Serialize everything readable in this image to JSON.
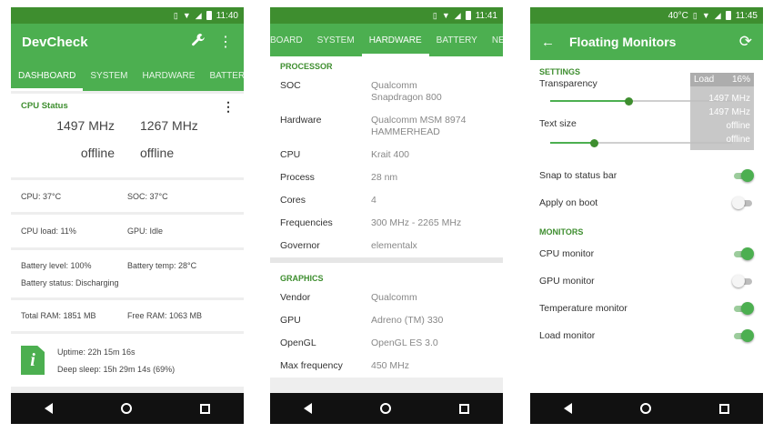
{
  "screen1": {
    "status_time": "11:40",
    "app_title": "DevCheck",
    "tabs": [
      "DASHBOARD",
      "SYSTEM",
      "HARDWARE",
      "BATTERY"
    ],
    "cpu_status": {
      "title": "CPU Status",
      "freqs": [
        "1497 MHz",
        "1267 MHz",
        "offline",
        "offline"
      ]
    },
    "temps": {
      "cpu": "CPU: 37°C",
      "soc": "SOC: 37°C"
    },
    "load": {
      "cpu": "CPU load: 11%",
      "gpu": "GPU: Idle"
    },
    "battery": {
      "level": "Battery level: 100%",
      "temp": "Battery temp: 28°C",
      "status": "Battery status: Discharging"
    },
    "ram": {
      "total": "Total RAM: 1851 MB",
      "free": "Free RAM: 1063 MB"
    },
    "uptime": {
      "uptime": "Uptime: 22h 15m 16s",
      "deep_sleep": "Deep sleep: 15h 29m 14s (69%)",
      "icon_letter": "i"
    }
  },
  "screen2": {
    "status_time": "11:41",
    "tabs": [
      "BOARD",
      "SYSTEM",
      "HARDWARE",
      "BATTERY",
      "NETW"
    ],
    "processor": {
      "header": "PROCESSOR",
      "rows": [
        {
          "k": "SOC",
          "v": "Qualcomm\nSnapdragon 800"
        },
        {
          "k": "Hardware",
          "v": "Qualcomm MSM 8974\nHAMMERHEAD"
        },
        {
          "k": "CPU",
          "v": "Krait 400"
        },
        {
          "k": "Process",
          "v": "28 nm"
        },
        {
          "k": "Cores",
          "v": "4"
        },
        {
          "k": "Frequencies",
          "v": "300 MHz - 2265 MHz"
        },
        {
          "k": "Governor",
          "v": "elementalx"
        }
      ]
    },
    "graphics": {
      "header": "GRAPHICS",
      "rows": [
        {
          "k": "Vendor",
          "v": "Qualcomm"
        },
        {
          "k": "GPU",
          "v": "Adreno (TM) 330"
        },
        {
          "k": "OpenGL",
          "v": "OpenGL ES 3.0"
        },
        {
          "k": "Max frequency",
          "v": "450 MHz"
        }
      ]
    }
  },
  "screen3": {
    "status_time": "11:45",
    "status_temp": "40°C",
    "title": "Floating Monitors",
    "settings_header": "SETTINGS",
    "transparency_label": "Transparency",
    "transparency_value": 0.43,
    "text_size_label": "Text size",
    "text_size_value": 0.24,
    "overlay": {
      "load_label": "Load",
      "load_value": "16%",
      "lines": [
        "1497 MHz",
        "1497 MHz",
        "offline",
        "offline"
      ]
    },
    "toggles": [
      {
        "label": "Snap to status bar",
        "on": true
      },
      {
        "label": "Apply on boot",
        "on": false
      }
    ],
    "monitors_header": "MONITORS",
    "monitors": [
      {
        "label": "CPU monitor",
        "on": true
      },
      {
        "label": "GPU monitor",
        "on": false
      },
      {
        "label": "Temperature monitor",
        "on": true
      },
      {
        "label": "Load monitor",
        "on": true
      }
    ]
  },
  "icons": [
    "vibrate-icon",
    "wifi-icon",
    "signal-icon",
    "battery-icon",
    "wrench-icon",
    "more-vert-icon",
    "back-arrow-icon",
    "refresh-icon",
    "nav-back-icon",
    "nav-home-icon",
    "nav-recents-icon",
    "info-file-icon"
  ]
}
